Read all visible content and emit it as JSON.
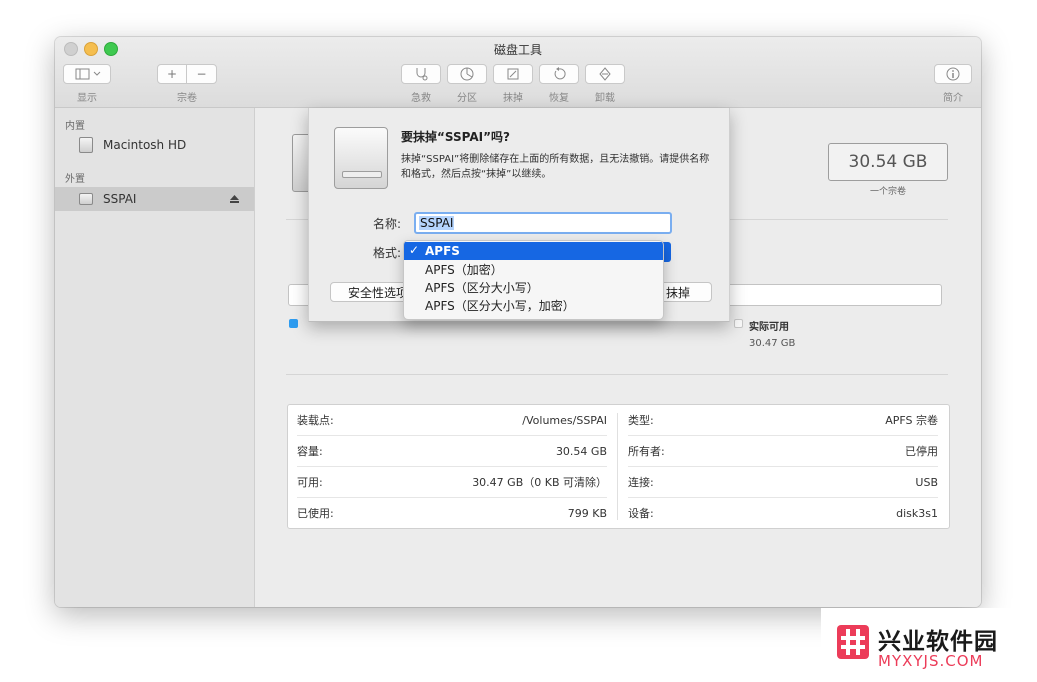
{
  "window": {
    "title": "磁盘工具"
  },
  "toolbar": {
    "sidebar_toggle_label": "显示",
    "volume_add_label": "+",
    "volume_remove_label": "−",
    "volume_label": "宗卷",
    "first_aid_label": "急救",
    "partition_label": "分区",
    "erase_label": "抹掉",
    "restore_label": "恢复",
    "unmount_label": "卸载",
    "info_label": "简介"
  },
  "sidebar": {
    "internal_header": "内置",
    "internal_items": [
      {
        "label": "Macintosh HD"
      }
    ],
    "external_header": "外置",
    "external_items": [
      {
        "label": "SSPAI",
        "selected": true
      }
    ]
  },
  "main": {
    "capacity": "30.54 GB",
    "capacity_caption": "一个宗卷",
    "available_legend": "实际可用",
    "available_value": "30.47 GB",
    "used_color": "#2e9cf0",
    "info_table": {
      "left": [
        {
          "label": "装载点:",
          "value": "/Volumes/SSPAI"
        },
        {
          "label": "容量:",
          "value": "30.54 GB"
        },
        {
          "label": "可用:",
          "value": "30.47 GB（0 KB 可清除）"
        },
        {
          "label": "已使用:",
          "value": "799 KB"
        }
      ],
      "right": [
        {
          "label": "类型:",
          "value": "APFS 宗卷"
        },
        {
          "label": "所有者:",
          "value": "已停用"
        },
        {
          "label": "连接:",
          "value": "USB"
        },
        {
          "label": "设备:",
          "value": "disk3s1"
        }
      ]
    }
  },
  "erase_sheet": {
    "title": "要抹掉“SSPAI”吗?",
    "description": "抹掉“SSPAI”将删除储存在上面的所有数据，且无法撤销。请提供名称和格式，然后点按“抹掉”以继续。",
    "name_label": "名称:",
    "name_value": "SSPAI",
    "format_label": "格式:",
    "security_button": "安全性选项",
    "erase_button": "抹掉",
    "format_options": [
      {
        "label": "APFS",
        "selected": true
      },
      {
        "label": "APFS（加密）",
        "selected": false
      },
      {
        "label": "APFS（区分大小写）",
        "selected": false
      },
      {
        "label": "APFS（区分大小写，加密）",
        "selected": false
      }
    ]
  },
  "watermark": {
    "title": "兴业软件园",
    "url": "MYXYJS.COM"
  },
  "colors": {
    "accent": "#1667e3",
    "watermark": "#ec3c59"
  }
}
